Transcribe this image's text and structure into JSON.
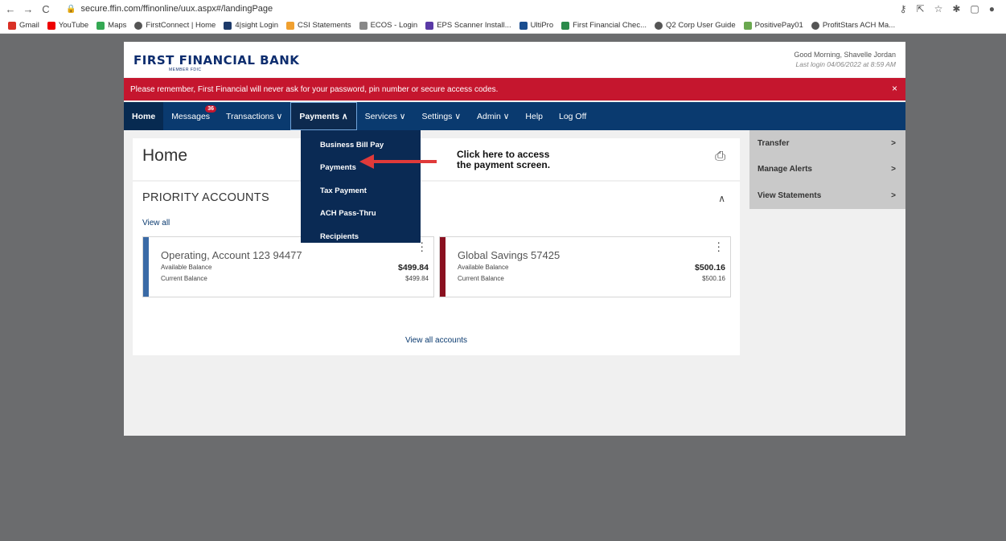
{
  "browser": {
    "url": "secure.ffin.com/ffinonline/uux.aspx#/landingPage",
    "bookmarks": [
      "Gmail",
      "YouTube",
      "Maps",
      "FirstConnect | Home",
      "4|sight Login",
      "CSI Statements",
      "ECOS - Login",
      "EPS Scanner Install...",
      "UltiPro",
      "First Financial Chec...",
      "Q2 Corp User Guide",
      "PositivePay01",
      "ProfitStars ACH Ma..."
    ]
  },
  "brand": {
    "logo": "FIRST FINANCIAL BANK",
    "logo_sub": "MEMBER FDIC",
    "greeting": "Good Morning, Shavelle Jordan",
    "last_login": "Last login 04/06/2022 at 8:59 AM"
  },
  "alert": {
    "text": "Please remember, First Financial will never ask for your password, pin number or secure access codes.",
    "close": "×"
  },
  "nav": {
    "home": "Home",
    "messages": "Messages",
    "messages_badge": "36",
    "transactions": "Transactions ∨",
    "payments": "Payments ∧",
    "services": "Services ∨",
    "settings": "Settings ∨",
    "admin": "Admin ∨",
    "help": "Help",
    "logoff": "Log Off"
  },
  "dropdown": [
    "Business Bill Pay",
    "Payments",
    "Tax Payment",
    "ACH Pass-Thru",
    "Recipients"
  ],
  "home": {
    "title": "Home"
  },
  "priority": {
    "title": "PRIORITY ACCOUNTS",
    "view_all": "View all",
    "view_all_accounts": "View all accounts",
    "accounts": [
      {
        "name": "Operating, Account 123 94477",
        "avail_label": "Available Balance",
        "avail": "$499.84",
        "curr_label": "Current Balance",
        "curr": "$499.84",
        "color": "#3a6aa6"
      },
      {
        "name": "Global Savings 57425",
        "avail_label": "Available Balance",
        "avail": "$500.16",
        "curr_label": "Current Balance",
        "curr": "$500.16",
        "color": "#8a1020"
      }
    ]
  },
  "sidebar": [
    {
      "label": "Transfer"
    },
    {
      "label": "Manage Alerts"
    },
    {
      "label": "View Statements"
    }
  ],
  "annotation": {
    "line1": "Click here to access",
    "line2": "the payment screen."
  },
  "colors": {
    "nav": "#0a3a6f",
    "alert": "#c5162e",
    "arrow": "#e03a3a"
  }
}
